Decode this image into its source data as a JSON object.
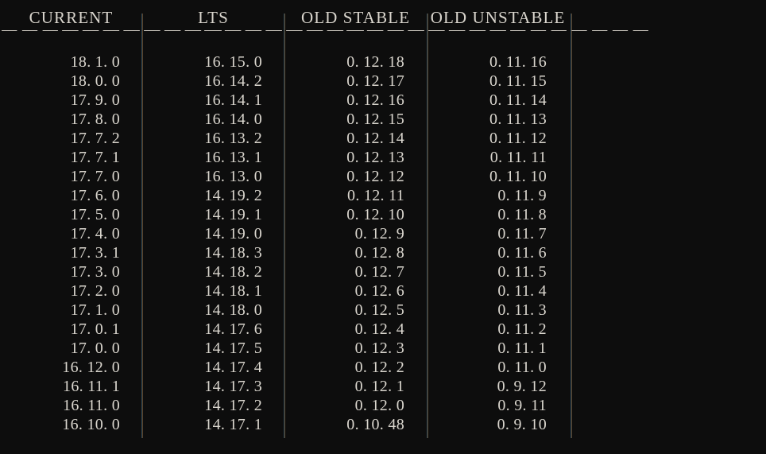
{
  "page": {
    "background_color": "#0d0d0d",
    "text_color": "#d9d5cd",
    "rule_color": "#4a4234",
    "title": "Release Version Columns"
  },
  "separator": {
    "dashes": "— — — — — — — — — — — — — — —"
  },
  "columns": [
    {
      "id": "current",
      "header": "CURRENT",
      "rows": [
        "18. 1. 0",
        "18. 0. 0",
        "17. 9. 0",
        "17. 8. 0",
        "17. 7. 2",
        "17. 7. 1",
        "17. 7. 0",
        "17. 6. 0",
        "17. 5. 0",
        "17. 4. 0",
        "17. 3. 1",
        "17. 3. 0",
        "17. 2. 0",
        "17. 1. 0",
        "17. 0. 1",
        "17. 0. 0",
        "16. 12. 0",
        "16. 11. 1",
        "16. 11. 0",
        "16. 10. 0"
      ]
    },
    {
      "id": "lts",
      "header": "LTS",
      "rows": [
        "16. 15. 0",
        "16. 14. 2",
        "16. 14. 1",
        "16. 14. 0",
        "16. 13. 2",
        "16. 13. 1",
        "16. 13. 0",
        "14. 19. 2",
        "14. 19. 1",
        "14. 19. 0",
        "14. 18. 3",
        "14. 18. 2",
        "14. 18. 1",
        "14. 18. 0",
        "14. 17. 6",
        "14. 17. 5",
        "14. 17. 4",
        "14. 17. 3",
        "14. 17. 2",
        "14. 17. 1"
      ]
    },
    {
      "id": "old-stable",
      "header": "OLD  STABLE",
      "rows": [
        "0. 12. 18",
        "0. 12. 17",
        "0. 12. 16",
        "0. 12. 15",
        "0. 12. 14",
        "0. 12. 13",
        "0. 12. 12",
        "0. 12. 11",
        "0. 12. 10",
        "0. 12. 9",
        "0. 12. 8",
        "0. 12. 7",
        "0. 12. 6",
        "0. 12. 5",
        "0. 12. 4",
        "0. 12. 3",
        "0. 12. 2",
        "0. 12. 1",
        "0. 12. 0",
        "0. 10. 48"
      ]
    },
    {
      "id": "old-unstable",
      "header": "OLD  UNSTABLE",
      "rows": [
        "0. 11. 16",
        "0. 11. 15",
        "0. 11. 14",
        "0. 11. 13",
        "0. 11. 12",
        "0. 11. 11",
        "0. 11. 10",
        "0. 11. 9",
        "0. 11. 8",
        "0. 11. 7",
        "0. 11. 6",
        "0. 11. 5",
        "0. 11. 4",
        "0. 11. 3",
        "0. 11. 2",
        "0. 11. 1",
        "0. 11. 0",
        "0. 9. 12",
        "0. 9. 11",
        "0. 9. 10"
      ]
    }
  ]
}
